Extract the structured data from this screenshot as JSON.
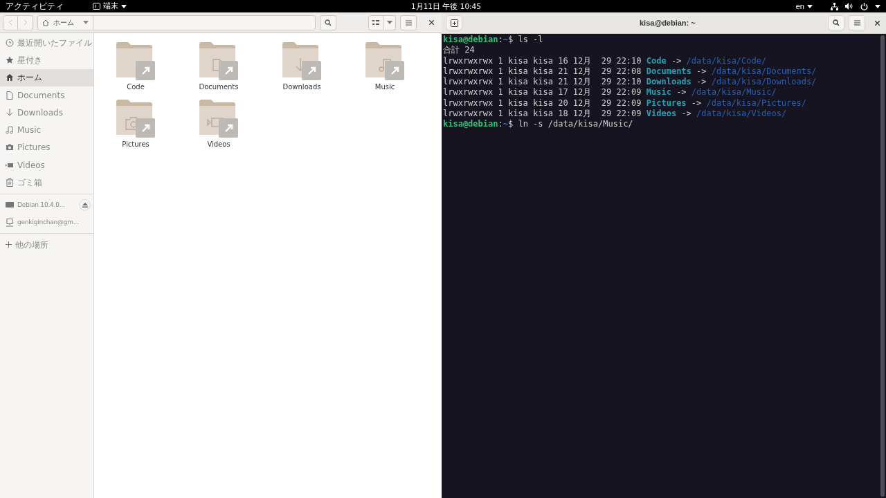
{
  "top_bar": {
    "activities": "アクティビティ",
    "app_menu": "端末",
    "clock": "1月11日 午後 10:45",
    "input_method": "en"
  },
  "file_manager": {
    "location": "ホーム",
    "sidebar": {
      "places": [
        {
          "kind": "recent",
          "label": "最近開いたファイル",
          "selected": false
        },
        {
          "kind": "star",
          "label": "星付き",
          "selected": false
        },
        {
          "kind": "home",
          "label": "ホーム",
          "selected": true
        },
        {
          "kind": "document",
          "label": "Documents",
          "selected": false
        },
        {
          "kind": "download",
          "label": "Downloads",
          "selected": false
        },
        {
          "kind": "music",
          "label": "Music",
          "selected": false
        },
        {
          "kind": "camera",
          "label": "Pictures",
          "selected": false
        },
        {
          "kind": "video",
          "label": "Videos",
          "selected": false
        },
        {
          "kind": "trash",
          "label": "ゴミ箱",
          "selected": false
        }
      ],
      "devices": [
        {
          "kind": "drive",
          "label": "Debian 10.4.0...",
          "eject": true,
          "selected": false
        },
        {
          "kind": "network",
          "label": "genkiginchan@gm...",
          "eject": false,
          "selected": false
        }
      ],
      "other": {
        "label": "他の場所",
        "selected": false
      }
    },
    "files": [
      {
        "name": "Code",
        "kind": "plain",
        "symlink": true
      },
      {
        "name": "Documents",
        "kind": "document",
        "symlink": true
      },
      {
        "name": "Downloads",
        "kind": "download",
        "symlink": true
      },
      {
        "name": "Music",
        "kind": "music",
        "symlink": true
      },
      {
        "name": "Pictures",
        "kind": "camera",
        "symlink": true
      },
      {
        "name": "Videos",
        "kind": "video",
        "symlink": true
      }
    ]
  },
  "terminal": {
    "title": "kisa@debian: ~",
    "lines": [
      {
        "kind": "prompt",
        "user": "kisa@debian",
        "separator": ":",
        "path": "~",
        "symbol": "$",
        "command": "ls -l"
      },
      {
        "kind": "text",
        "text": "合計 24"
      },
      {
        "kind": "link",
        "info": "lrwxrwxrwx 1 kisa kisa 16 12月  29 22:10",
        "name": "Code",
        "arrow": "->",
        "target": "/data/kisa/Code/"
      },
      {
        "kind": "link",
        "info": "lrwxrwxrwx 1 kisa kisa 21 12月  29 22:08",
        "name": "Documents",
        "arrow": "->",
        "target": "/data/kisa/Documents/"
      },
      {
        "kind": "link",
        "info": "lrwxrwxrwx 1 kisa kisa 21 12月  29 22:10",
        "name": "Downloads",
        "arrow": "->",
        "target": "/data/kisa/Downloads/"
      },
      {
        "kind": "link",
        "info": "lrwxrwxrwx 1 kisa kisa 17 12月  29 22:09",
        "name": "Music",
        "arrow": "->",
        "target": "/data/kisa/Music/"
      },
      {
        "kind": "link",
        "info": "lrwxrwxrwx 1 kisa kisa 20 12月  29 22:09",
        "name": "Pictures",
        "arrow": "->",
        "target": "/data/kisa/Pictures/"
      },
      {
        "kind": "link",
        "info": "lrwxrwxrwx 1 kisa kisa 18 12月  29 22:09",
        "name": "Videos",
        "arrow": "->",
        "target": "/data/kisa/Videos/"
      },
      {
        "kind": "prompt",
        "user": "kisa@debian",
        "separator": ":",
        "path": "~",
        "symbol": "$",
        "command": "ln -s /data/kisa/Music/"
      }
    ]
  }
}
